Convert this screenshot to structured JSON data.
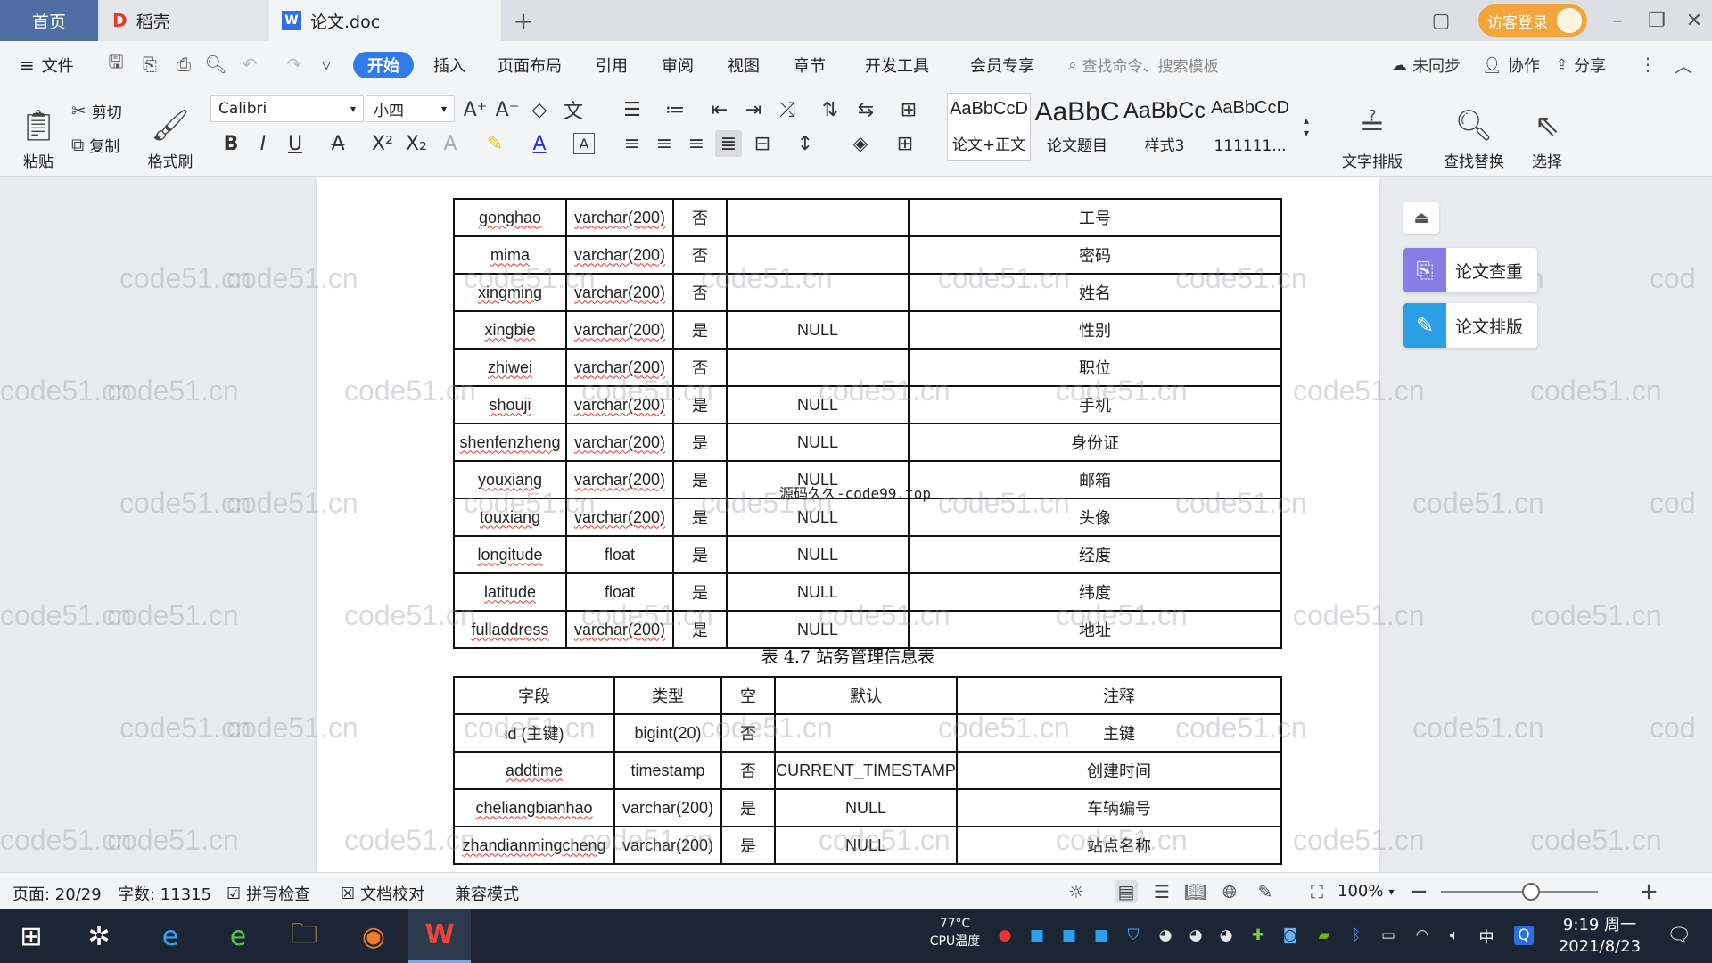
{
  "tabs": {
    "home": "首页",
    "daoke": "稻壳",
    "doc": "论文.doc"
  },
  "title_bar": {
    "login": "访客登录"
  },
  "menu": {
    "file": "文件",
    "items": [
      "开始",
      "插入",
      "页面布局",
      "引用",
      "审阅",
      "视图",
      "章节",
      "开发工具",
      "会员专享"
    ],
    "search_placeholder": "查找命令、搜索模板",
    "sync": "未同步",
    "collab": "协作",
    "share": "分享"
  },
  "ribbon": {
    "paste": "粘贴",
    "cut": "剪切",
    "copy": "复制",
    "format_painter": "格式刷",
    "font_name": "Calibri",
    "font_size": "小四",
    "styles": [
      {
        "sample": "AaBbCcD",
        "label": "论文+正文"
      },
      {
        "sample": "AaBbC",
        "label": "论文题目"
      },
      {
        "sample": "AaBbCc",
        "label": "样式3"
      },
      {
        "sample": "AaBbCcD",
        "label": "111111..."
      }
    ],
    "text_layout": "文字排版",
    "find_replace": "查找替换",
    "select": "选择"
  },
  "side_panel": {
    "check": "论文查重",
    "layout": "论文排版"
  },
  "document": {
    "watermark": "code51.cn",
    "overlay": "源码久久-code99.top",
    "table1_rows": [
      [
        "gonghao",
        "varchar(200)",
        "否",
        "",
        "工号"
      ],
      [
        "mima",
        "varchar(200)",
        "否",
        "",
        "密码"
      ],
      [
        "xingming",
        "varchar(200)",
        "否",
        "",
        "姓名"
      ],
      [
        "xingbie",
        "varchar(200)",
        "是",
        "NULL",
        "性别"
      ],
      [
        "zhiwei",
        "varchar(200)",
        "否",
        "",
        "职位"
      ],
      [
        "shouji",
        "varchar(200)",
        "是",
        "NULL",
        "手机"
      ],
      [
        "shenfenzheng",
        "varchar(200)",
        "是",
        "NULL",
        "身份证"
      ],
      [
        "youxiang",
        "varchar(200)",
        "是",
        "NULL",
        "邮箱"
      ],
      [
        "touxiang",
        "varchar(200)",
        "是",
        "NULL",
        "头像"
      ],
      [
        "longitude",
        "float",
        "是",
        "NULL",
        "经度"
      ],
      [
        "latitude",
        "float",
        "是",
        "NULL",
        "纬度"
      ],
      [
        "fulladdress",
        "varchar(200)",
        "是",
        "NULL",
        "地址"
      ]
    ],
    "caption2": "表 4.7  站务管理信息表",
    "table2_header": [
      "字段",
      "类型",
      "空",
      "默认",
      "注释"
    ],
    "table2_rows": [
      [
        "id (主键)",
        "bigint(20)",
        "否",
        "",
        "主键"
      ],
      [
        "addtime",
        "timestamp",
        "否",
        "CURRENT_TIMESTAMP",
        "创建时间"
      ],
      [
        "cheliangbianhao",
        "varchar(200)",
        "是",
        "NULL",
        "车辆编号"
      ],
      [
        "zhandianmingcheng",
        "varchar(200)",
        "是",
        "NULL",
        "站点名称"
      ]
    ]
  },
  "status": {
    "page": "页面: 20/29",
    "words": "字数: 11315",
    "spell": "拼写检查",
    "proof": "文档校对",
    "compat": "兼容模式",
    "zoom": "100%"
  },
  "taskbar": {
    "temp": "77°C",
    "cpu": "CPU温度",
    "ime": "中",
    "time": "9:19 周一",
    "date": "2021/8/23"
  }
}
